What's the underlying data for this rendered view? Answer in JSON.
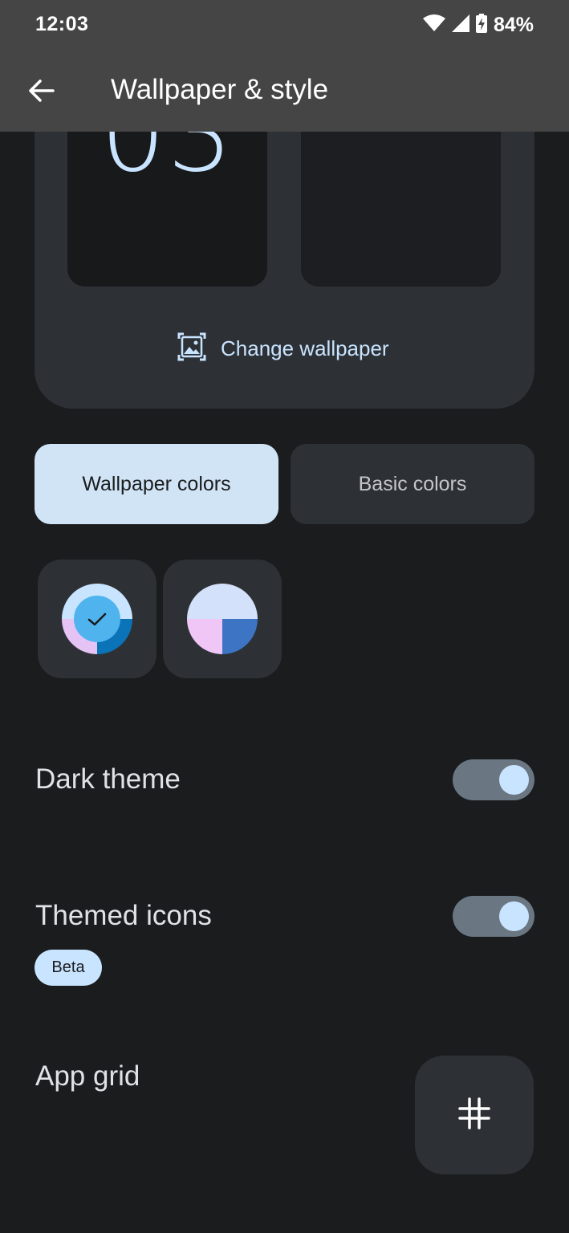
{
  "status_bar": {
    "time": "12:03",
    "battery_percent": "84%",
    "icons": [
      "wifi-icon",
      "signal-icon",
      "battery-charging-icon"
    ]
  },
  "app_bar": {
    "title": "Wallpaper & style",
    "back_icon": "arrow-back-icon"
  },
  "preview": {
    "clock_digits": "03",
    "change_wallpaper_label": "Change wallpaper",
    "change_wallpaper_icon": "wallpaper-icon"
  },
  "tabs": [
    {
      "label": "Wallpaper colors",
      "selected": true
    },
    {
      "label": "Basic colors",
      "selected": false
    }
  ],
  "color_options": [
    {
      "selected": true,
      "colors": [
        "#c9e4ff",
        "#e6c3f5",
        "#0b74b8",
        "#4fb4ee"
      ]
    },
    {
      "selected": false,
      "colors": [
        "#d3e1fb",
        "#f0c6f7",
        "#3d74c4"
      ]
    }
  ],
  "settings": {
    "dark_theme": {
      "label": "Dark theme",
      "enabled": true
    },
    "themed_icons": {
      "label": "Themed icons",
      "badge": "Beta",
      "enabled": true
    },
    "app_grid": {
      "label": "App grid",
      "icon": "grid-icon"
    }
  },
  "colors": {
    "background": "#1a1c1e",
    "app_bar": "#454545",
    "accent": "#c9e4ff",
    "surface": "#2d3135",
    "tab_selected": "#d1e4f6"
  }
}
